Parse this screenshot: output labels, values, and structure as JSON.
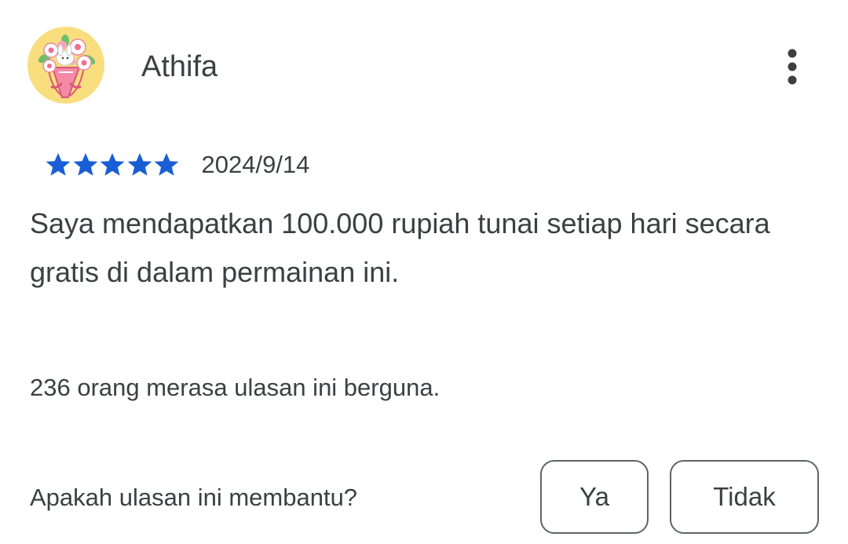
{
  "review": {
    "author": "Athifa",
    "avatar_icon": "flower-bouquet-avatar",
    "more_icon": "more-vert-icon",
    "rating": 5,
    "rating_max": 5,
    "star_color": "#1a5ed6",
    "date": "2024/9/14",
    "text": "Saya mendapatkan 100.000 rupiah tunai setiap hari secara gratis di dalam permainan ini."
  },
  "helpful": {
    "count_text": "236 orang merasa ulasan ini berguna.",
    "question": "Apakah ulasan ini membantu?",
    "yes_label": "Ya",
    "no_label": "Tidak"
  }
}
